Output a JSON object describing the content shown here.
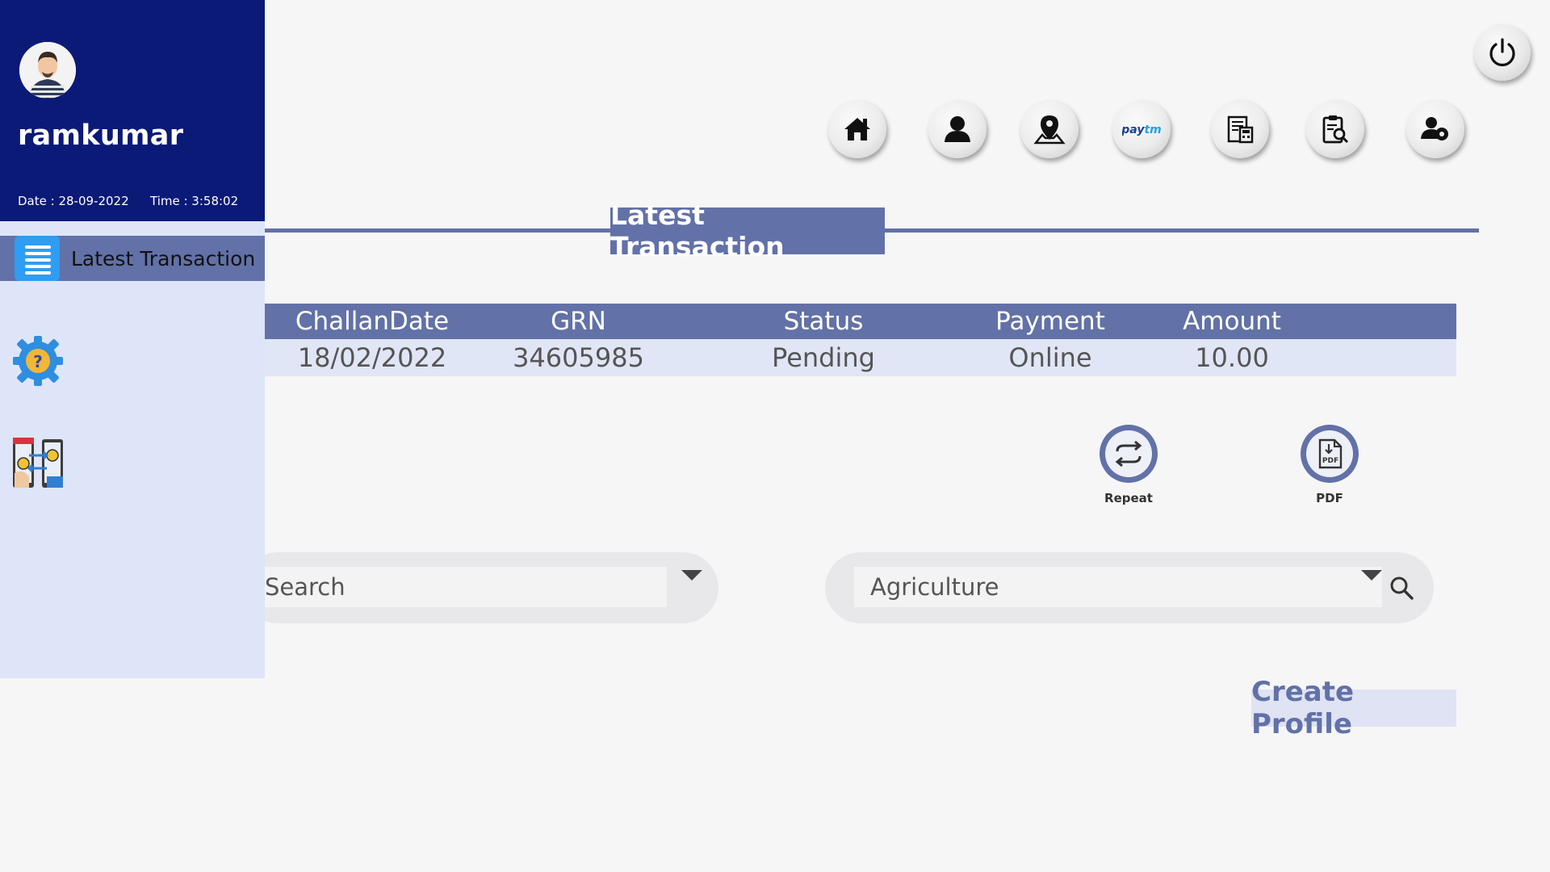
{
  "user": {
    "name": "ramkumar",
    "date_text": "Date : 28-09-2022",
    "time_text": "Time : 3:58:02"
  },
  "sidebar": {
    "active_item": {
      "label": "Latest Transaction",
      "icon": "list-icon"
    },
    "items": [
      {
        "icon": "settings-help-gear-icon"
      },
      {
        "icon": "mobile-money-exchange-icon"
      }
    ]
  },
  "topnav": {
    "power_icon": "power-icon",
    "icons": [
      "home-icon",
      "user-icon",
      "map-pin-icon",
      "paytm-icon",
      "receipt-calculator-icon",
      "clipboard-search-icon",
      "user-settings-icon"
    ],
    "paytm_label": "Paytm"
  },
  "section": {
    "title": "Latest Transaction"
  },
  "table": {
    "headers": [
      "ChallanDate",
      "GRN",
      "Status",
      "Payment",
      "Amount"
    ],
    "rows": [
      [
        "18/02/2022",
        "34605985",
        "Pending",
        "Online",
        "10.00"
      ]
    ]
  },
  "actions": {
    "repeat_label": "Repeat",
    "pdf_label": "PDF"
  },
  "search": {
    "left_value": "Search",
    "right_value": "Agriculture"
  },
  "create_profile_label": "Create Profile",
  "colors": {
    "sidebar_header": "#0b1a77",
    "accent": "#6271a7",
    "sidebar_bg": "#dfe5f8",
    "row_bg": "#e1e6f6"
  }
}
